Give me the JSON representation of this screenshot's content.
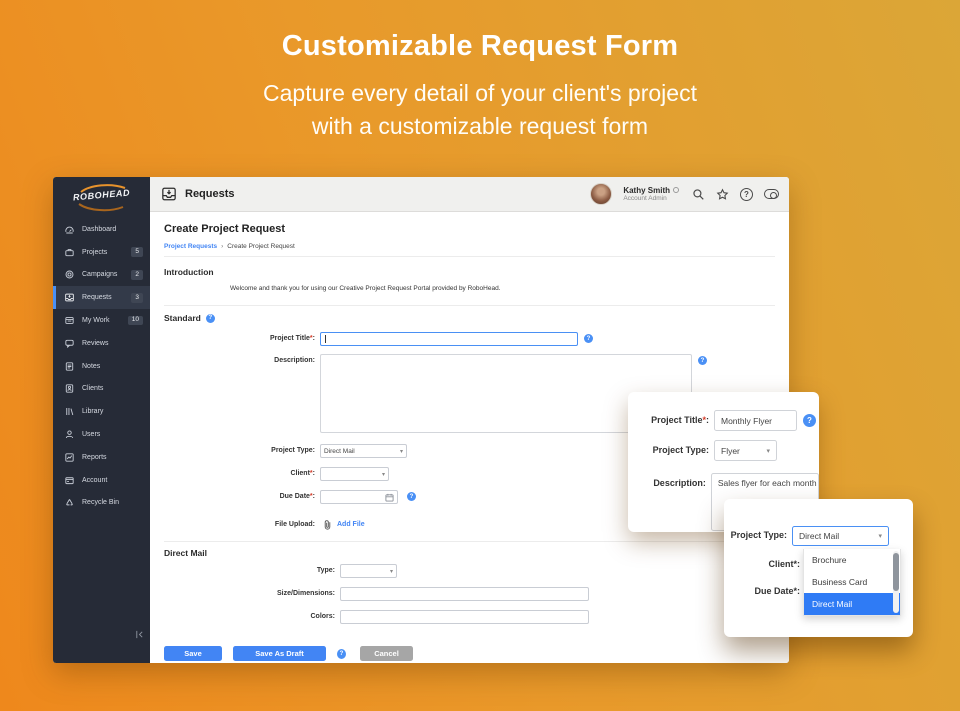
{
  "hero": {
    "title": "Customizable Request Form",
    "subtitle1": "Capture every detail of your client's project",
    "subtitle2": "with a customizable request form"
  },
  "icons": {
    "help": "?",
    "caret": "▾"
  },
  "sidebar": {
    "logo": "ROBOHEAD",
    "items": [
      {
        "label": "Dashboard",
        "badge": ""
      },
      {
        "label": "Projects",
        "badge": "5"
      },
      {
        "label": "Campaigns",
        "badge": "2"
      },
      {
        "label": "Requests",
        "badge": "3"
      },
      {
        "label": "My Work",
        "badge": "10"
      },
      {
        "label": "Reviews",
        "badge": ""
      },
      {
        "label": "Notes",
        "badge": ""
      },
      {
        "label": "Clients",
        "badge": ""
      },
      {
        "label": "Library",
        "badge": ""
      },
      {
        "label": "Users",
        "badge": ""
      },
      {
        "label": "Reports",
        "badge": ""
      },
      {
        "label": "Account",
        "badge": ""
      },
      {
        "label": "Recycle Bin",
        "badge": ""
      }
    ]
  },
  "header": {
    "title": "Requests",
    "user_name": "Kathy Smith",
    "user_role": "Account Admin"
  },
  "page": {
    "heading": "Create Project Request",
    "breadcrumb_link": "Project Requests",
    "breadcrumb_sep": "›",
    "breadcrumb_current": "Create Project Request",
    "intro_heading": "Introduction",
    "intro_text": "Welcome and thank you for using our Creative Project Request Portal provided by RoboHead.",
    "standard_heading": "Standard",
    "fields": {
      "project_title": {
        "label": "Project Title",
        "req": "*",
        "colon": ":"
      },
      "description": {
        "label": "Description",
        "req": "",
        "colon": ":"
      },
      "project_type": {
        "label": "Project Type",
        "req": "",
        "colon": ":",
        "value": "Direct Mail"
      },
      "client": {
        "label": "Client",
        "req": "*",
        "colon": ":"
      },
      "due_date": {
        "label": "Due Date",
        "req": "*",
        "colon": ":"
      },
      "file_upload": {
        "label": "File Upload",
        "req": "",
        "colon": ":",
        "link": "Add File"
      }
    },
    "direct_mail_heading": "Direct Mail",
    "dm_fields": {
      "type": {
        "label": "Type",
        "colon": ":"
      },
      "size": {
        "label": "Size/Dimensions",
        "colon": ":"
      },
      "colors": {
        "label": "Colors",
        "colon": ":"
      }
    },
    "buttons": {
      "save": "Save",
      "save_draft": "Save As Draft",
      "cancel": "Cancel"
    }
  },
  "popup1": {
    "title_label": "Project Title",
    "title_req": "*",
    "colon": ":",
    "title_value": "Monthly Flyer",
    "type_label": "Project Type",
    "type_value": "Flyer",
    "desc_label": "Description",
    "desc_value": "Sales flyer for each month"
  },
  "popup2": {
    "type_label": "Project Type",
    "colon": ":",
    "type_value": "Direct Mail",
    "client_label": "Client",
    "client_req": "*",
    "due_label": "Due Date",
    "due_req": "*",
    "options": [
      "Brochure",
      "Business Card",
      "Direct Mail"
    ]
  },
  "colors": {
    "accent": "#4285f4",
    "dropdown_highlight": "#2f7bf5",
    "sidebar_bg": "#262b37",
    "gradient_start": "#ee881c",
    "gradient_end": "#dba637"
  }
}
